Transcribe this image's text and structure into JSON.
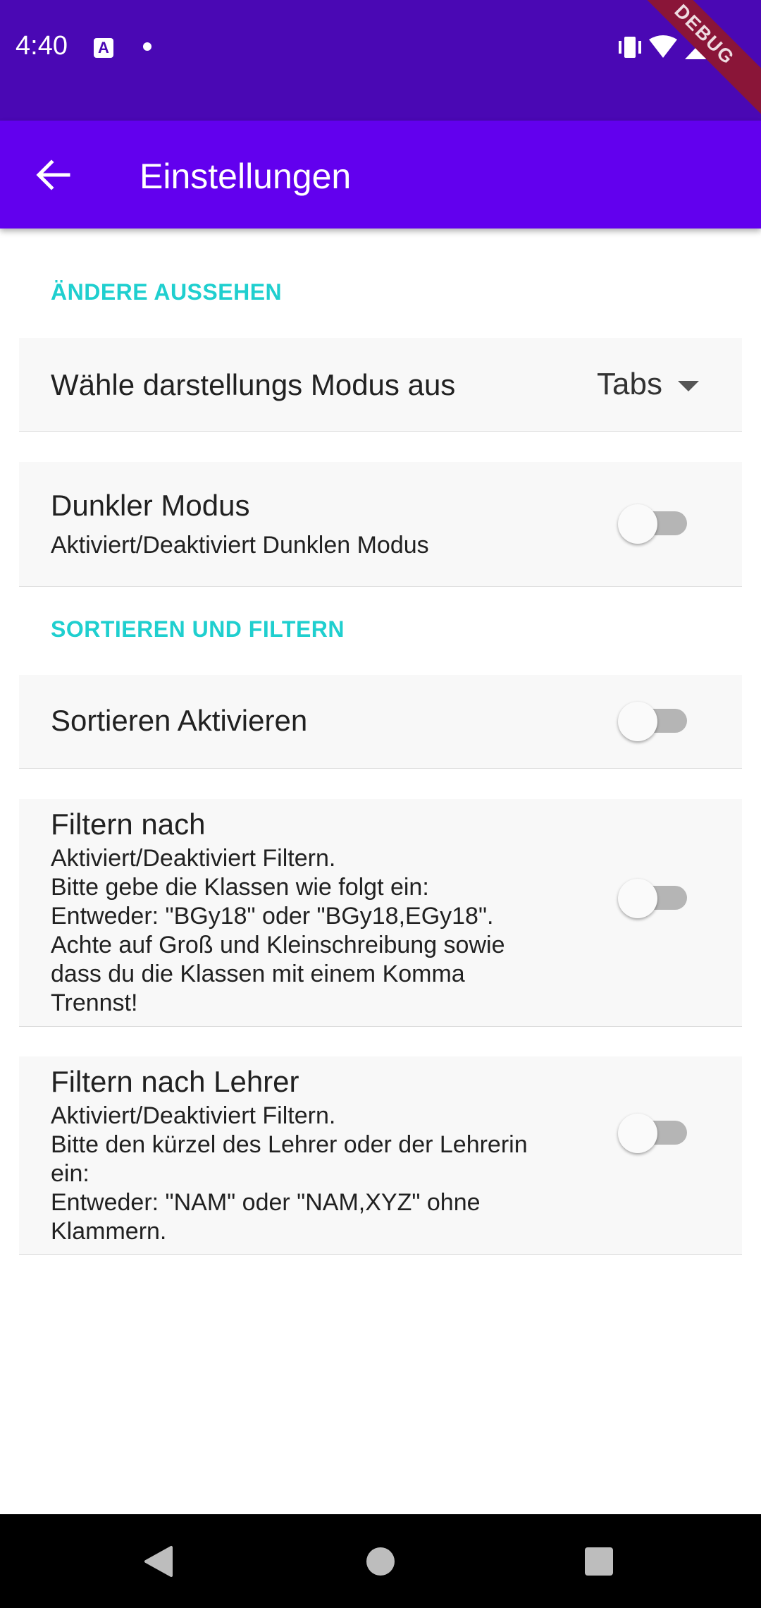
{
  "status_bar": {
    "time": "4:40",
    "icons": [
      "a-notification-icon",
      "dot-icon",
      "vibrate-icon",
      "wifi-icon",
      "signal-icon",
      "battery-icon"
    ],
    "debug_banner": "DEBUG"
  },
  "app_bar": {
    "title": "Einstellungen",
    "back_icon": "arrow-back-icon"
  },
  "sections": [
    {
      "header": "ÄNDERE AUSSEHEN"
    },
    {
      "header": "SORTIEREN UND FILTERN"
    }
  ],
  "settings": {
    "display_mode": {
      "title": "Wähle darstellungs Modus aus",
      "selected": "Tabs"
    },
    "dark_mode": {
      "title": "Dunkler Modus",
      "subtitle": "Aktiviert/Deaktiviert Dunklen Modus",
      "enabled": false
    },
    "sort": {
      "title": "Sortieren Aktivieren",
      "enabled": false
    },
    "filter_class": {
      "title": "Filtern nach",
      "subtitle": "Aktiviert/Deaktiviert Filtern.\nBitte gebe die Klassen wie folgt ein:\nEntweder: \"BGy18\" oder \"BGy18,EGy18\".\nAchte auf Groß und Kleinschreibung sowie\ndass du die Klassen mit einem Komma\nTrennst!",
      "enabled": false
    },
    "filter_teacher": {
      "title": "Filtern nach Lehrer",
      "subtitle": "Aktiviert/Deaktiviert Filtern.\nBitte den kürzel des Lehrer oder der Lehrerin\nein:\nEntweder: \"NAM\" oder \"NAM,XYZ\" ohne\nKlammern.",
      "enabled": false
    }
  },
  "nav_bar": {
    "buttons": [
      "back-triangle-icon",
      "home-circle-icon",
      "recents-square-icon"
    ]
  },
  "colors": {
    "status_bar": "#4a08b4",
    "app_bar": "#6200ee",
    "section_header": "#1fcfcf",
    "tile_background": "#f8f8f8",
    "switch_track": "#b5b5b5"
  }
}
